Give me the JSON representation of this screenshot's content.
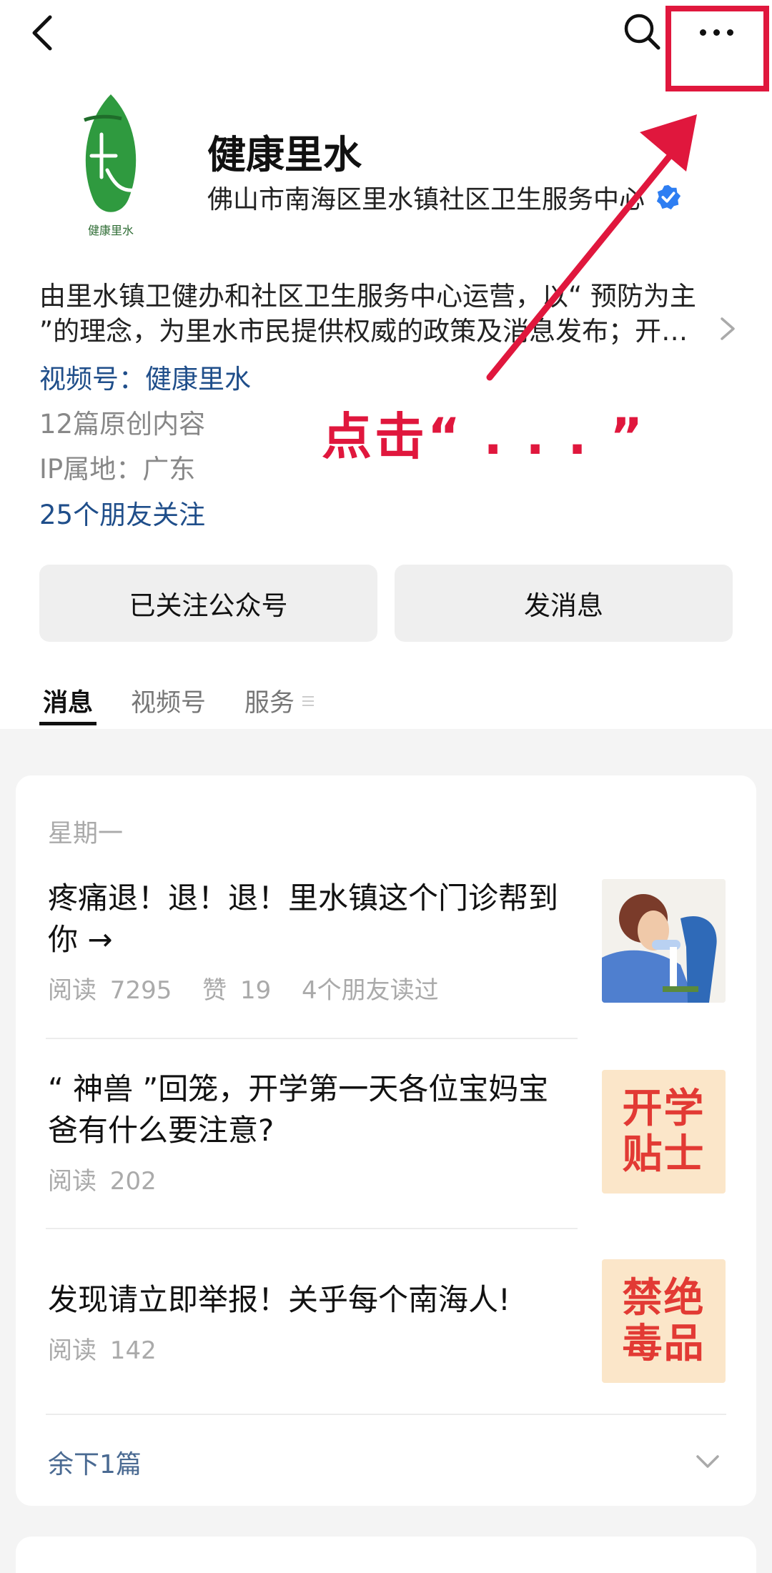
{
  "account": {
    "name": "健康里水",
    "organization": "佛山市南海区里水镇社区卫生服务中心",
    "description": "由里水镇卫健办和社区卫生服务中心运营，以“ 预防为主 ”的理念，为里水市民提供权威的政策及消息发布；开…",
    "channel": "视频号：健康里水",
    "original_count": "12篇原创内容",
    "ip_location": "IP属地：广东",
    "friends_follow": "25个朋友关注",
    "logo_caption": "健康里水"
  },
  "annotation": {
    "text": "点击“ . . . ”",
    "color": "#e0173d"
  },
  "buttons": {
    "followed": "已关注公众号",
    "message": "发消息"
  },
  "tabs": [
    {
      "label": "消息"
    },
    {
      "label": "视频号"
    },
    {
      "label": "服务"
    }
  ],
  "feed": {
    "day_label": "星期一",
    "articles": [
      {
        "title": "疼痛退！退！退！里水镇这个门诊帮到你 →",
        "meta": [
          "阅读 7295",
          "赞 19",
          "4个朋友读过"
        ],
        "thumb": "illustration"
      },
      {
        "title": "“ 神兽 ”回笼，开学第一天各位宝妈宝爸有什么要注意?",
        "meta": [
          "阅读 202"
        ],
        "thumb": "开学贴士"
      },
      {
        "title": "发现请立即举报！关乎每个南海人!",
        "meta": [
          "阅读 142"
        ],
        "thumb": "禁绝毒品"
      }
    ],
    "remaining": "余下1篇"
  },
  "thumb_texts": {
    "school_tips": [
      "开学",
      "贴士"
    ],
    "no_drugs": [
      "禁绝",
      "毒品"
    ]
  }
}
